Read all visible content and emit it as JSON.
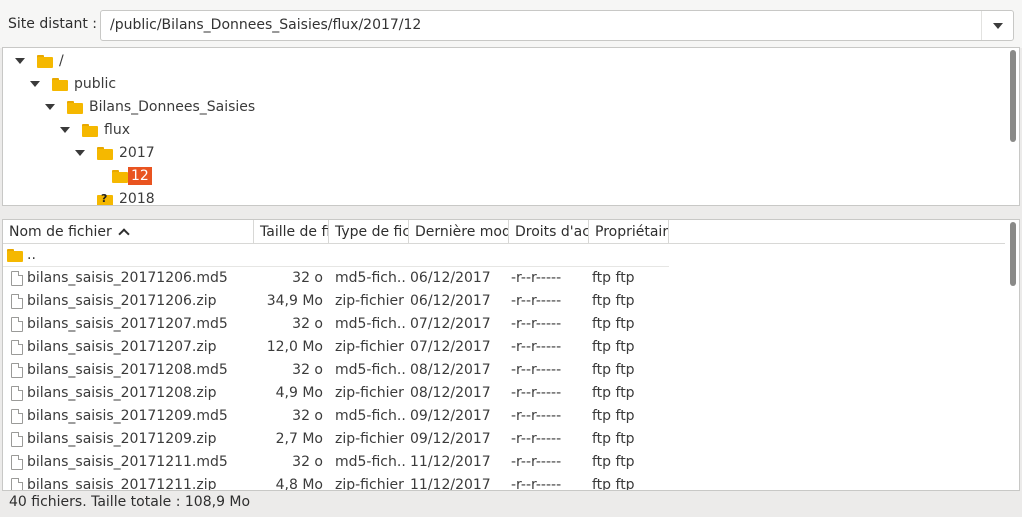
{
  "site": {
    "label": "Site distant :",
    "path": "/public/Bilans_Donnees_Saisies/flux/2017/12"
  },
  "tree": {
    "items": [
      {
        "label": "/",
        "icon": "folder-icon",
        "expanded": true
      },
      {
        "label": "public",
        "icon": "folder-icon",
        "expanded": true
      },
      {
        "label": "Bilans_Donnees_Saisies",
        "icon": "folder-icon",
        "expanded": true
      },
      {
        "label": "flux",
        "icon": "folder-icon",
        "expanded": true
      },
      {
        "label": "2017",
        "icon": "folder-icon",
        "expanded": true
      },
      {
        "label": "12",
        "icon": "folder-icon",
        "selected": true
      },
      {
        "label": "2018",
        "icon": "folder-unknown-icon"
      }
    ]
  },
  "list": {
    "columns": [
      "Nom de fichier",
      "Taille de fi",
      "Type de fic",
      "Dernière mod",
      "Droits d'ac",
      "Propriétair"
    ],
    "parent": "..",
    "files": [
      {
        "name": "bilans_saisis_20171206.md5",
        "size": "32 o",
        "type": "md5-fich...",
        "date": "06/12/2017",
        "perms": "-r--r-----",
        "owner": "ftp ftp"
      },
      {
        "name": "bilans_saisis_20171206.zip",
        "size": "34,9 Mo",
        "type": "zip-fichier",
        "date": "06/12/2017",
        "perms": "-r--r-----",
        "owner": "ftp ftp"
      },
      {
        "name": "bilans_saisis_20171207.md5",
        "size": "32 o",
        "type": "md5-fich...",
        "date": "07/12/2017",
        "perms": "-r--r-----",
        "owner": "ftp ftp"
      },
      {
        "name": "bilans_saisis_20171207.zip",
        "size": "12,0 Mo",
        "type": "zip-fichier",
        "date": "07/12/2017",
        "perms": "-r--r-----",
        "owner": "ftp ftp"
      },
      {
        "name": "bilans_saisis_20171208.md5",
        "size": "32 o",
        "type": "md5-fich...",
        "date": "08/12/2017",
        "perms": "-r--r-----",
        "owner": "ftp ftp"
      },
      {
        "name": "bilans_saisis_20171208.zip",
        "size": "4,9 Mo",
        "type": "zip-fichier",
        "date": "08/12/2017",
        "perms": "-r--r-----",
        "owner": "ftp ftp"
      },
      {
        "name": "bilans_saisis_20171209.md5",
        "size": "32 o",
        "type": "md5-fich...",
        "date": "09/12/2017",
        "perms": "-r--r-----",
        "owner": "ftp ftp"
      },
      {
        "name": "bilans_saisis_20171209.zip",
        "size": "2,7 Mo",
        "type": "zip-fichier",
        "date": "09/12/2017",
        "perms": "-r--r-----",
        "owner": "ftp ftp"
      },
      {
        "name": "bilans_saisis_20171211.md5",
        "size": "32 o",
        "type": "md5-fich...",
        "date": "11/12/2017",
        "perms": "-r--r-----",
        "owner": "ftp ftp"
      },
      {
        "name": "bilans_saisis_20171211.zip",
        "size": "4,8 Mo",
        "type": "zip-fichier",
        "date": "11/12/2017",
        "perms": "-r--r-----",
        "owner": "ftp ftp"
      }
    ]
  },
  "status": {
    "text": "40 fichiers. Taille totale : 108,9 Mo"
  },
  "colors": {
    "selection": "#e95420",
    "folder": "#f5b800"
  }
}
